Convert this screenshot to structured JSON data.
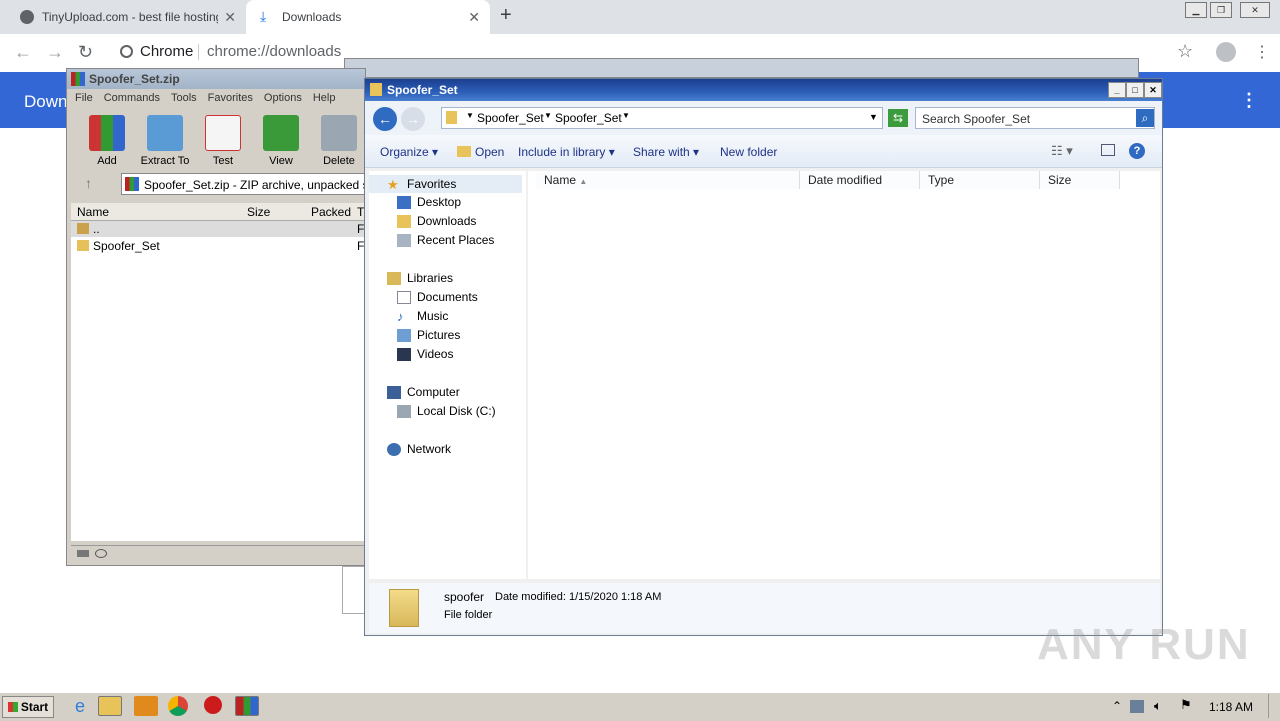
{
  "chrome": {
    "tabs": [
      {
        "label": "TinyUpload.com - best file hosting so"
      },
      {
        "label": "Downloads"
      }
    ],
    "omnibox": {
      "scheme_label": "Chrome",
      "url": "chrome://downloads"
    },
    "page_header": "Down"
  },
  "winrar": {
    "title": "Spoofer_Set.zip",
    "menu": [
      "File",
      "Commands",
      "Tools",
      "Favorites",
      "Options",
      "Help"
    ],
    "toolbar": [
      "Add",
      "Extract To",
      "Test",
      "View",
      "Delete"
    ],
    "path": "Spoofer_Set.zip - ZIP archive, unpacked size",
    "columns": [
      "Name",
      "Size",
      "Packed",
      "T"
    ],
    "rows": [
      {
        "name": "..",
        "type": "F"
      },
      {
        "name": "Spoofer_Set",
        "type": "F"
      }
    ]
  },
  "explorer": {
    "title": "Spoofer_Set",
    "breadcrumb": [
      "Spoofer_Set",
      "Spoofer_Set"
    ],
    "search_placeholder": "Search Spoofer_Set",
    "commands": [
      "Organize",
      "Open",
      "Include in library",
      "Share with",
      "New folder"
    ],
    "nav": {
      "favorites": {
        "label": "Favorites",
        "items": [
          "Desktop",
          "Downloads",
          "Recent Places"
        ]
      },
      "libraries": {
        "label": "Libraries",
        "items": [
          "Documents",
          "Music",
          "Pictures",
          "Videos"
        ]
      },
      "computer": {
        "label": "Computer",
        "items": [
          "Local Disk (C:)"
        ]
      },
      "network": {
        "label": "Network"
      }
    },
    "columns": [
      "Name",
      "Date modified",
      "Type",
      "Size"
    ],
    "details": {
      "name": "spoofer",
      "modified_label": "Date modified:",
      "modified_value": "1/15/2020 1:18 AM",
      "type": "File folder"
    }
  },
  "taskbar": {
    "start": "Start",
    "clock": "1:18 AM"
  },
  "watermark": "ANY RUN",
  "colors": {
    "chrome_blue": "#3367d6",
    "explorer_title": "#2b5fb8"
  }
}
